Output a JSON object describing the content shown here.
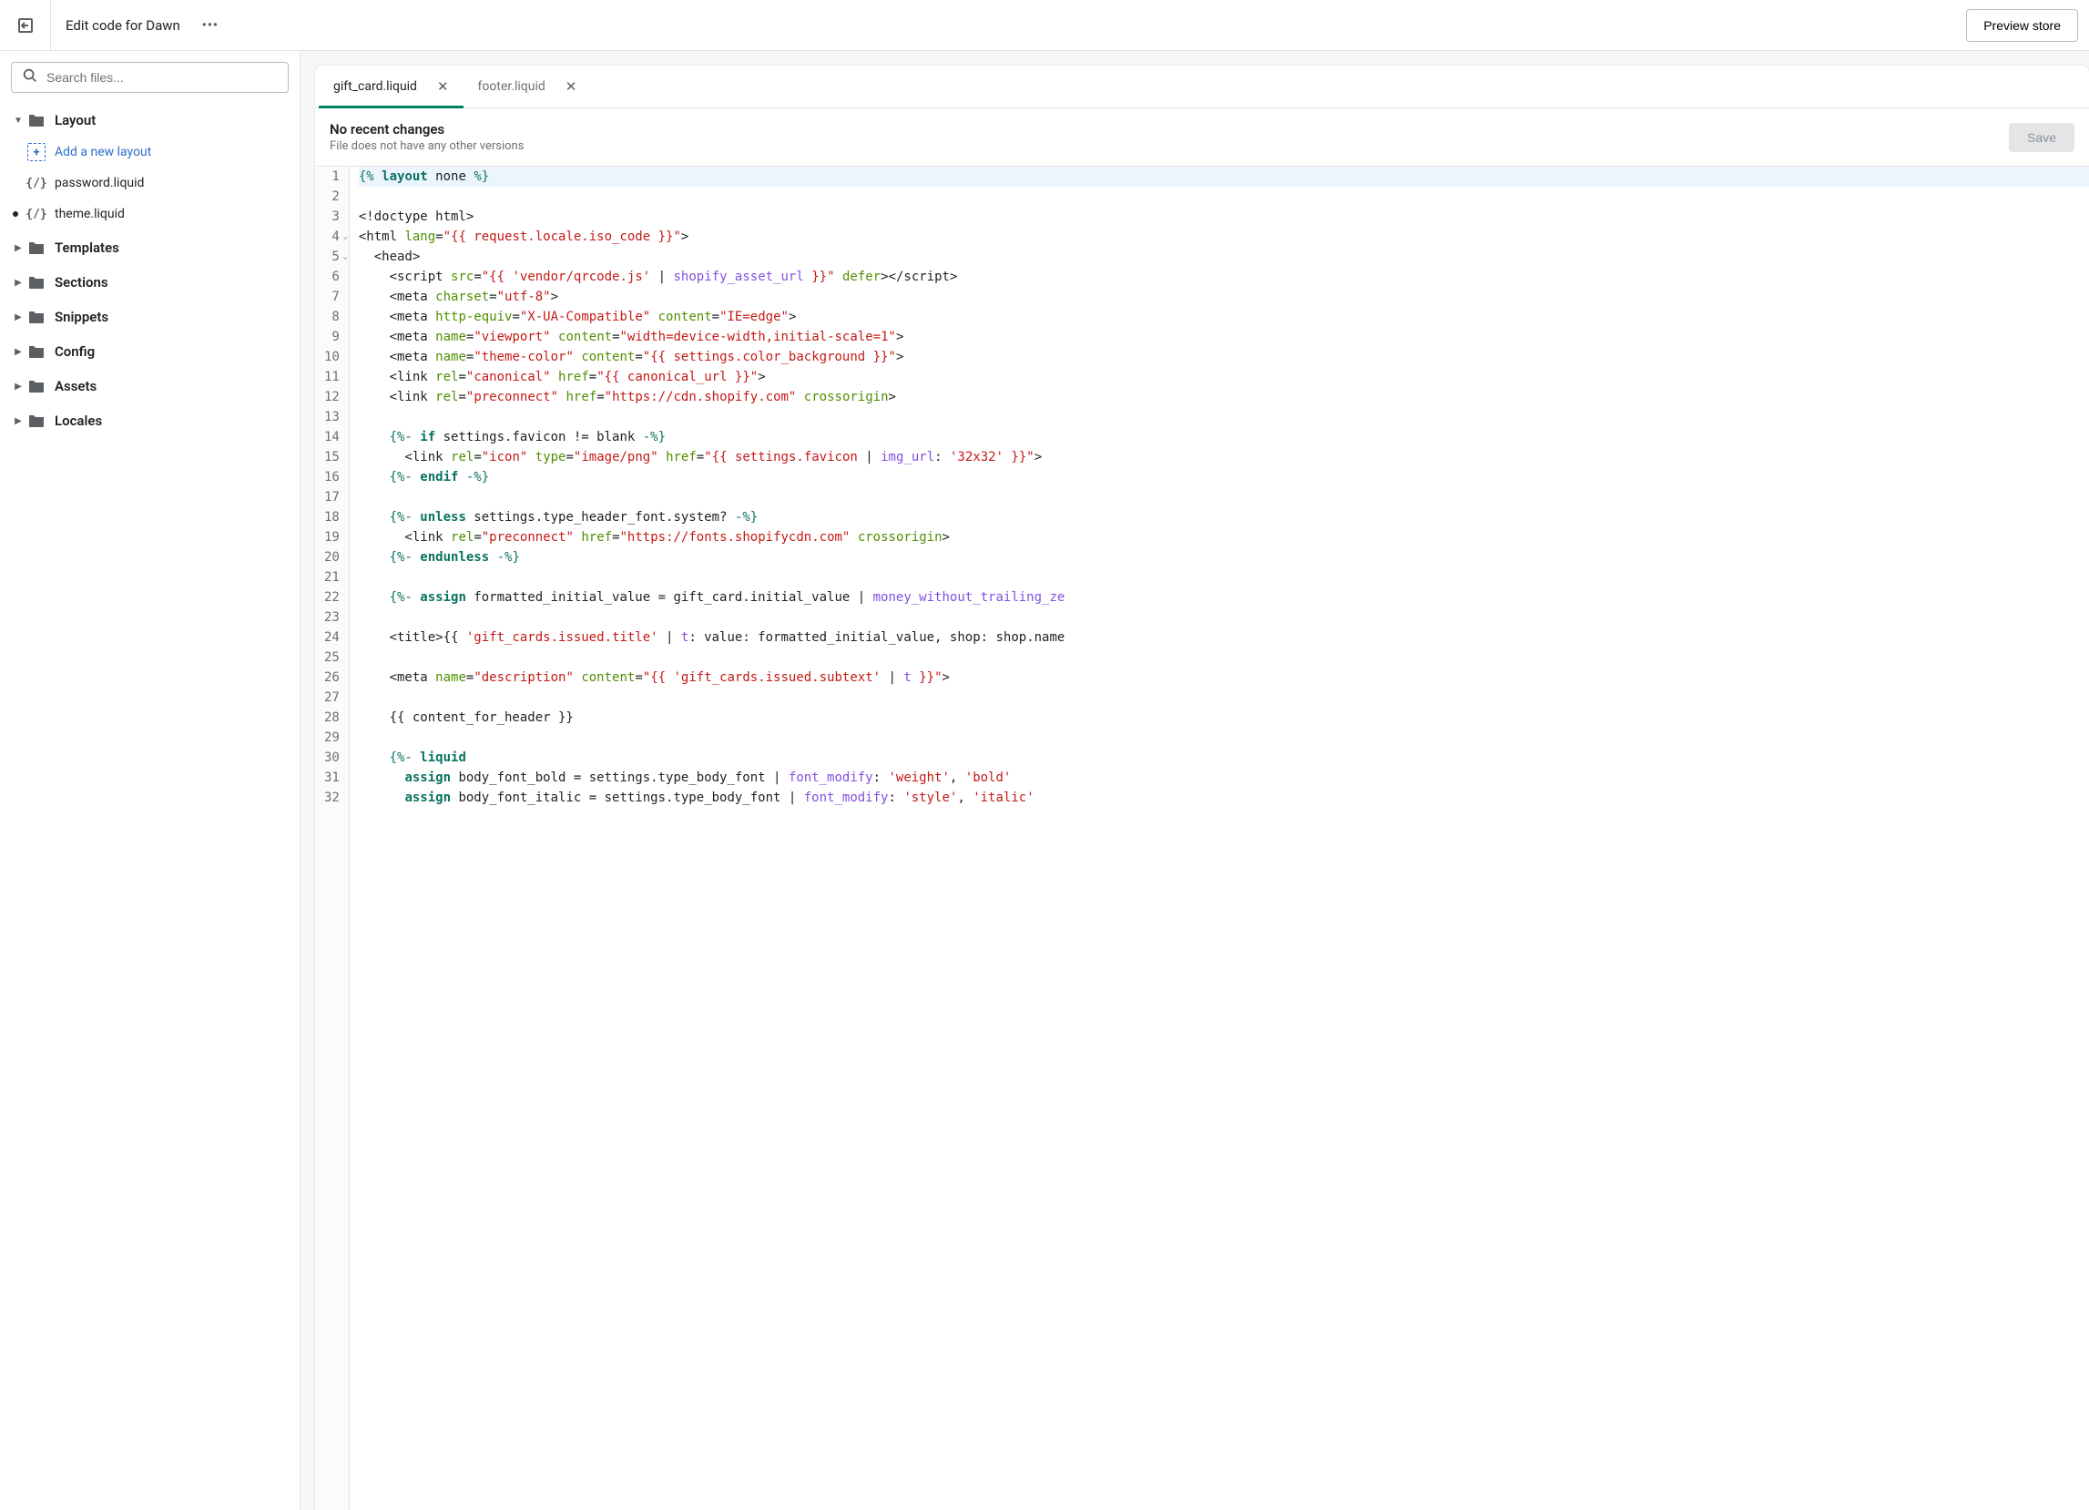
{
  "topbar": {
    "title": "Edit code for Dawn",
    "preview_label": "Preview store"
  },
  "search": {
    "placeholder": "Search files..."
  },
  "tree": {
    "add_layout_label": "Add a new layout",
    "groups": {
      "layout": "Layout",
      "templates": "Templates",
      "sections": "Sections",
      "snippets": "Snippets",
      "config": "Config",
      "assets": "Assets",
      "locales": "Locales"
    },
    "layout_files": [
      "password.liquid",
      "theme.liquid"
    ]
  },
  "tabs": [
    {
      "label": "gift_card.liquid",
      "active": true
    },
    {
      "label": "footer.liquid",
      "active": false
    }
  ],
  "status": {
    "title": "No recent changes",
    "subtitle": "File does not have any other versions",
    "save_label": "Save"
  },
  "code": [
    [
      {
        "c": "t-tag",
        "t": "{% "
      },
      {
        "c": "t-kw",
        "t": "layout"
      },
      {
        "c": "",
        "t": " none "
      },
      {
        "c": "t-tag",
        "t": "%}"
      }
    ],
    [],
    [
      {
        "c": "",
        "t": "<!doctype html>"
      }
    ],
    [
      {
        "c": "",
        "t": "<html "
      },
      {
        "c": "t-attr",
        "t": "lang"
      },
      {
        "c": "",
        "t": "="
      },
      {
        "c": "t-str",
        "t": "\"{{ request.locale.iso_code }}\""
      },
      {
        "c": "",
        "t": ">"
      }
    ],
    [
      {
        "c": "",
        "t": "  <head>"
      }
    ],
    [
      {
        "c": "",
        "t": "    <script "
      },
      {
        "c": "t-attr",
        "t": "src"
      },
      {
        "c": "",
        "t": "="
      },
      {
        "c": "t-str",
        "t": "\"{{ 'vendor/qrcode.js' "
      },
      {
        "c": "",
        "t": "|"
      },
      {
        "c": "t-pipe",
        "t": " shopify_asset_url "
      },
      {
        "c": "t-str",
        "t": "}}\""
      },
      {
        "c": "",
        "t": " "
      },
      {
        "c": "t-attr",
        "t": "defer"
      },
      {
        "c": "",
        "t": "></script>"
      }
    ],
    [
      {
        "c": "",
        "t": "    <meta "
      },
      {
        "c": "t-attr",
        "t": "charset"
      },
      {
        "c": "",
        "t": "="
      },
      {
        "c": "t-str",
        "t": "\"utf-8\""
      },
      {
        "c": "",
        "t": ">"
      }
    ],
    [
      {
        "c": "",
        "t": "    <meta "
      },
      {
        "c": "t-attr",
        "t": "http-equiv"
      },
      {
        "c": "",
        "t": "="
      },
      {
        "c": "t-str",
        "t": "\"X-UA-Compatible\""
      },
      {
        "c": "",
        "t": " "
      },
      {
        "c": "t-attr",
        "t": "content"
      },
      {
        "c": "",
        "t": "="
      },
      {
        "c": "t-str",
        "t": "\"IE=edge\""
      },
      {
        "c": "",
        "t": ">"
      }
    ],
    [
      {
        "c": "",
        "t": "    <meta "
      },
      {
        "c": "t-attr",
        "t": "name"
      },
      {
        "c": "",
        "t": "="
      },
      {
        "c": "t-str",
        "t": "\"viewport\""
      },
      {
        "c": "",
        "t": " "
      },
      {
        "c": "t-attr",
        "t": "content"
      },
      {
        "c": "",
        "t": "="
      },
      {
        "c": "t-str",
        "t": "\"width=device-width,initial-scale=1\""
      },
      {
        "c": "",
        "t": ">"
      }
    ],
    [
      {
        "c": "",
        "t": "    <meta "
      },
      {
        "c": "t-attr",
        "t": "name"
      },
      {
        "c": "",
        "t": "="
      },
      {
        "c": "t-str",
        "t": "\"theme-color\""
      },
      {
        "c": "",
        "t": " "
      },
      {
        "c": "t-attr",
        "t": "content"
      },
      {
        "c": "",
        "t": "="
      },
      {
        "c": "t-str",
        "t": "\"{{ settings.color_background }}\""
      },
      {
        "c": "",
        "t": ">"
      }
    ],
    [
      {
        "c": "",
        "t": "    <link "
      },
      {
        "c": "t-attr",
        "t": "rel"
      },
      {
        "c": "",
        "t": "="
      },
      {
        "c": "t-str",
        "t": "\"canonical\""
      },
      {
        "c": "",
        "t": " "
      },
      {
        "c": "t-attr",
        "t": "href"
      },
      {
        "c": "",
        "t": "="
      },
      {
        "c": "t-str",
        "t": "\"{{ canonical_url }}\""
      },
      {
        "c": "",
        "t": ">"
      }
    ],
    [
      {
        "c": "",
        "t": "    <link "
      },
      {
        "c": "t-attr",
        "t": "rel"
      },
      {
        "c": "",
        "t": "="
      },
      {
        "c": "t-str",
        "t": "\"preconnect\""
      },
      {
        "c": "",
        "t": " "
      },
      {
        "c": "t-attr",
        "t": "href"
      },
      {
        "c": "",
        "t": "="
      },
      {
        "c": "t-str",
        "t": "\"https://cdn.shopify.com\""
      },
      {
        "c": "",
        "t": " "
      },
      {
        "c": "t-attr",
        "t": "crossorigin"
      },
      {
        "c": "",
        "t": ">"
      }
    ],
    [],
    [
      {
        "c": "",
        "t": "    "
      },
      {
        "c": "t-tag",
        "t": "{%- "
      },
      {
        "c": "t-kw",
        "t": "if"
      },
      {
        "c": "",
        "t": " settings.favicon != blank "
      },
      {
        "c": "t-tag",
        "t": "-%}"
      }
    ],
    [
      {
        "c": "",
        "t": "      <link "
      },
      {
        "c": "t-attr",
        "t": "rel"
      },
      {
        "c": "",
        "t": "="
      },
      {
        "c": "t-str",
        "t": "\"icon\""
      },
      {
        "c": "",
        "t": " "
      },
      {
        "c": "t-attr",
        "t": "type"
      },
      {
        "c": "",
        "t": "="
      },
      {
        "c": "t-str",
        "t": "\"image/png\""
      },
      {
        "c": "",
        "t": " "
      },
      {
        "c": "t-attr",
        "t": "href"
      },
      {
        "c": "",
        "t": "="
      },
      {
        "c": "t-str",
        "t": "\"{{ settings.favicon "
      },
      {
        "c": "",
        "t": "|"
      },
      {
        "c": "t-pipe",
        "t": " img_url"
      },
      {
        "c": "",
        "t": ": "
      },
      {
        "c": "t-str",
        "t": "'32x32' }}\""
      },
      {
        "c": "",
        "t": ">"
      }
    ],
    [
      {
        "c": "",
        "t": "    "
      },
      {
        "c": "t-tag",
        "t": "{%- "
      },
      {
        "c": "t-kw",
        "t": "endif"
      },
      {
        "c": "t-tag",
        "t": " -%}"
      }
    ],
    [],
    [
      {
        "c": "",
        "t": "    "
      },
      {
        "c": "t-tag",
        "t": "{%- "
      },
      {
        "c": "t-kw",
        "t": "unless"
      },
      {
        "c": "",
        "t": " settings.type_header_font.system? "
      },
      {
        "c": "t-tag",
        "t": "-%}"
      }
    ],
    [
      {
        "c": "",
        "t": "      <link "
      },
      {
        "c": "t-attr",
        "t": "rel"
      },
      {
        "c": "",
        "t": "="
      },
      {
        "c": "t-str",
        "t": "\"preconnect\""
      },
      {
        "c": "",
        "t": " "
      },
      {
        "c": "t-attr",
        "t": "href"
      },
      {
        "c": "",
        "t": "="
      },
      {
        "c": "t-str",
        "t": "\"https://fonts.shopifycdn.com\""
      },
      {
        "c": "",
        "t": " "
      },
      {
        "c": "t-attr",
        "t": "crossorigin"
      },
      {
        "c": "",
        "t": ">"
      }
    ],
    [
      {
        "c": "",
        "t": "    "
      },
      {
        "c": "t-tag",
        "t": "{%- "
      },
      {
        "c": "t-kw",
        "t": "endunless"
      },
      {
        "c": "t-tag",
        "t": " -%}"
      }
    ],
    [],
    [
      {
        "c": "",
        "t": "    "
      },
      {
        "c": "t-tag",
        "t": "{%- "
      },
      {
        "c": "t-kw",
        "t": "assign"
      },
      {
        "c": "",
        "t": " formatted_initial_value = gift_card.initial_value | "
      },
      {
        "c": "t-pipe",
        "t": "money_without_trailing_ze"
      }
    ],
    [],
    [
      {
        "c": "",
        "t": "    <title>{{ "
      },
      {
        "c": "t-str",
        "t": "'gift_cards.issued.title'"
      },
      {
        "c": "",
        "t": " | "
      },
      {
        "c": "t-pipe",
        "t": "t"
      },
      {
        "c": "",
        "t": ": value: formatted_initial_value, shop: shop.name"
      }
    ],
    [],
    [
      {
        "c": "",
        "t": "    <meta "
      },
      {
        "c": "t-attr",
        "t": "name"
      },
      {
        "c": "",
        "t": "="
      },
      {
        "c": "t-str",
        "t": "\"description\""
      },
      {
        "c": "",
        "t": " "
      },
      {
        "c": "t-attr",
        "t": "content"
      },
      {
        "c": "",
        "t": "="
      },
      {
        "c": "t-str",
        "t": "\"{{ 'gift_cards.issued.subtext' "
      },
      {
        "c": "",
        "t": "|"
      },
      {
        "c": "t-pipe",
        "t": " t "
      },
      {
        "c": "t-str",
        "t": "}}\""
      },
      {
        "c": "",
        "t": ">"
      }
    ],
    [],
    [
      {
        "c": "",
        "t": "    {{ content_for_header }}"
      }
    ],
    [],
    [
      {
        "c": "",
        "t": "    "
      },
      {
        "c": "t-tag",
        "t": "{%- "
      },
      {
        "c": "t-kw",
        "t": "liquid"
      }
    ],
    [
      {
        "c": "",
        "t": "      "
      },
      {
        "c": "t-kw",
        "t": "assign"
      },
      {
        "c": "",
        "t": " body_font_bold = settings.type_body_font | "
      },
      {
        "c": "t-pipe",
        "t": "font_modify"
      },
      {
        "c": "",
        "t": ": "
      },
      {
        "c": "t-str",
        "t": "'weight'"
      },
      {
        "c": "",
        "t": ", "
      },
      {
        "c": "t-str",
        "t": "'bold'"
      }
    ],
    [
      {
        "c": "",
        "t": "      "
      },
      {
        "c": "t-kw",
        "t": "assign"
      },
      {
        "c": "",
        "t": " body_font_italic = settings.type_body_font | "
      },
      {
        "c": "t-pipe",
        "t": "font_modify"
      },
      {
        "c": "",
        "t": ": "
      },
      {
        "c": "t-str",
        "t": "'style'"
      },
      {
        "c": "",
        "t": ", "
      },
      {
        "c": "t-str",
        "t": "'italic'"
      }
    ]
  ],
  "fold_lines": [
    4,
    5
  ]
}
